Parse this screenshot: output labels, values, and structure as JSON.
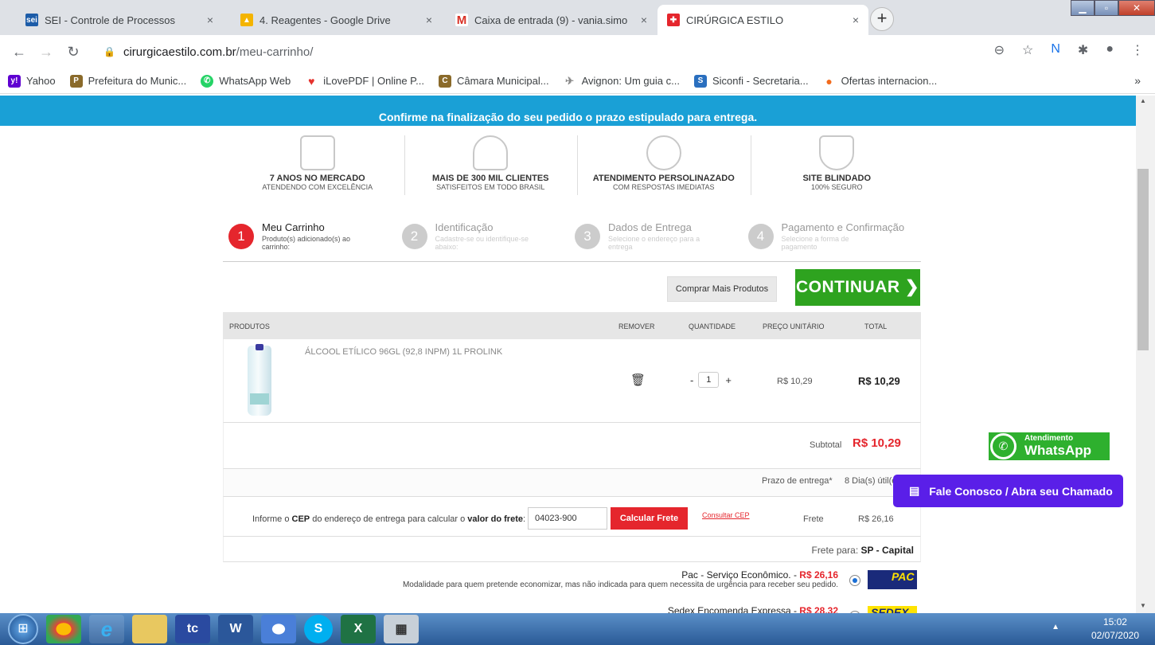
{
  "browser": {
    "tabs": [
      {
        "label": "SEI - Controle de Processos",
        "favicon": "sei",
        "color": "#1c5ca8"
      },
      {
        "label": "4. Reagentes - Google Drive",
        "favicon": "drive",
        "color": "#f4b400"
      },
      {
        "label": "Caixa de entrada (9) - vania.simo",
        "favicon": "M",
        "color": "#d93025"
      },
      {
        "label": "CIRÚRGICA ESTILO",
        "favicon": "+",
        "color": "#e5262d"
      }
    ],
    "close_glyph": "×",
    "new_tab_glyph": "+",
    "url_domain": "cirurgicaestilo.com.br",
    "url_path": "/meu-carrinho/",
    "bookmarks": [
      {
        "label": "Yahoo",
        "icon": "y!",
        "color": "#5f01d1"
      },
      {
        "label": "Prefeitura do Munic...",
        "icon": "P",
        "color": "#8a6a2a"
      },
      {
        "label": "WhatsApp Web",
        "icon": "W",
        "color": "#25d366"
      },
      {
        "label": "iLovePDF | Online P...",
        "icon": "♥",
        "color": "#e5322d"
      },
      {
        "label": "Câmara Municipal...",
        "icon": "C",
        "color": "#8a6a2a"
      },
      {
        "label": "Avignon: Um guia c...",
        "icon": "✈",
        "color": "#888888"
      },
      {
        "label": "Siconfi - Secretaria...",
        "icon": "S",
        "color": "#2a6fbf"
      },
      {
        "label": "Ofertas internacion...",
        "icon": "●",
        "color": "#f26b1d"
      }
    ],
    "bookmarks_more": "»"
  },
  "site": {
    "banner_text": "Confirme na finalização do seu pedido o prazo estipulado para entrega.",
    "features": [
      {
        "title": "7 ANOS NO MERCADO",
        "subtitle": "ATENDENDO COM EXCELÊNCIA",
        "icon": "calendar-icon"
      },
      {
        "title": "MAIS DE 300 MIL CLIENTES",
        "subtitle": "SATISFEITOS EM TODO BRASIL",
        "icon": "users-icon"
      },
      {
        "title": "ATENDIMENTO PERSOLINAZADO",
        "subtitle": "COM RESPOSTAS IMEDIATAS",
        "icon": "headset-icon"
      },
      {
        "title": "SITE BLINDADO",
        "subtitle": "100% SEGURO",
        "icon": "shield-icon"
      }
    ],
    "steps": [
      {
        "num": "1",
        "label": "Meu Carrinho",
        "desc": "Produto(s) adicionado(s) ao carrinho:"
      },
      {
        "num": "2",
        "label": "Identificação",
        "desc": "Cadastre-se ou identifique-se abaixo:"
      },
      {
        "num": "3",
        "label": "Dados de Entrega",
        "desc": "Selecione o endereço para a entrega"
      },
      {
        "num": "4",
        "label": "Pagamento e Confirmação",
        "desc": "Selecione a forma de pagamento"
      }
    ],
    "buy_more": "Comprar Mais Produtos",
    "continue": "CONTINUAR",
    "continue_arrow": "❯",
    "table_headers": {
      "products": "PRODUTOS",
      "remove": "REMOVER",
      "quantity": "QUANTIDADE",
      "unit_price": "PREÇO UNITÁRIO",
      "total": "TOTAL"
    },
    "product": {
      "name": "ÁLCOOL ETÍLICO 96GL (92,8 INPM) 1L PROLINK",
      "qty": "1",
      "unit_price": "R$ 10,29",
      "total": "R$ 10,29"
    },
    "qty_minus": "-",
    "qty_plus": "+",
    "subtotal_label": "Subtotal",
    "subtotal_value": "R$ 10,29",
    "prazo_label": "Prazo de entrega*",
    "prazo_value": "8 Dia(s) útil(eis)",
    "cep_text_1": "Informe o ",
    "cep_bold_1": "CEP",
    "cep_text_2": " do endereço de entrega para calcular o ",
    "cep_bold_2": "valor do frete",
    "cep_text_3": ":",
    "cep_value": "04023-900",
    "calc_button": "Calcular Frete",
    "consult_cep": "Consultar CEP",
    "frete_label": "Frete",
    "frete_value": "R$ 26,16",
    "frete_para_label": "Frete para:",
    "frete_para_value": "SP - Capital",
    "shipping_options": [
      {
        "name": "Pac - Serviço Econômico.",
        "price": "R$ 26,16",
        "desc": "Modalidade para quem pretende economizar, mas não indicada para quem necessita de urgência para receber seu pedido.",
        "selected": true,
        "logo": "PAC"
      },
      {
        "name": "Sedex Encomenda Expressa",
        "price": "R$ 28,32",
        "desc": "",
        "selected": false,
        "logo": "SEDEX"
      }
    ],
    "price_separator": " - ",
    "whatsapp_line1": "Atendimento",
    "whatsapp_line2": "WhatsApp",
    "contact_button": "Fale Conosco / Abra seu Chamado"
  },
  "taskbar": {
    "items": [
      "chrome",
      "ie",
      "explorer",
      "tc",
      "word",
      "chrome2",
      "skype",
      "excel",
      "calculator"
    ],
    "time": "15:02",
    "date": "02/07/2020"
  }
}
